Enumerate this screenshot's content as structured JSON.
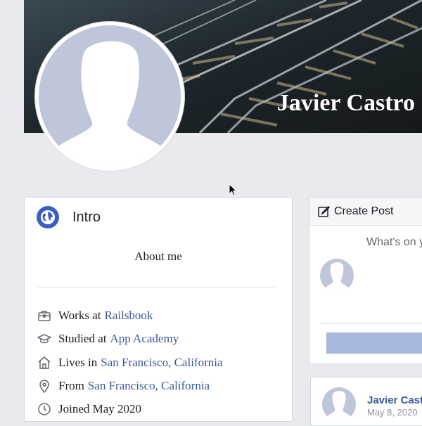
{
  "profile": {
    "name": "Javier Castro"
  },
  "intro": {
    "title": "Intro",
    "about_label": "About me",
    "rows": [
      {
        "icon": "briefcase-icon",
        "prefix": "Works at",
        "value": "Railsbook"
      },
      {
        "icon": "graduation-cap-icon",
        "prefix": "Studied at",
        "value": "App Academy"
      },
      {
        "icon": "home-icon",
        "prefix": "Lives in",
        "value": "San Francisco, California"
      },
      {
        "icon": "location-pin-icon",
        "prefix": "From",
        "value": "San Francisco, California"
      },
      {
        "icon": "clock-icon",
        "prefix": "Joined May 2020",
        "value": ""
      }
    ]
  },
  "create_post": {
    "title": "Create Post",
    "placeholder": "What's on y"
  },
  "post": {
    "author": "Javier Castr",
    "date": "May 8, 2020"
  },
  "colors": {
    "link": "#385898",
    "avatar_placeholder": "#bfc6da",
    "post_button": "#a6b8dc",
    "globe": "#3b5ec6"
  }
}
